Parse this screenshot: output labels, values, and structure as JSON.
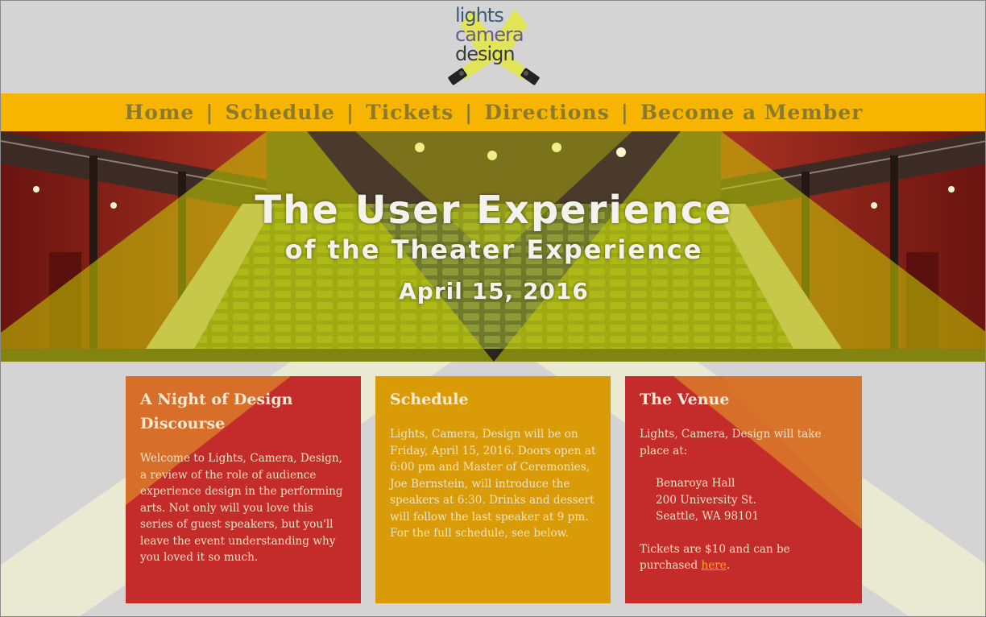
{
  "logo": {
    "lines": [
      "lights",
      "camera",
      "design"
    ]
  },
  "nav": {
    "items": [
      "Home",
      "Schedule",
      "Tickets",
      "Directions",
      "Become a Member"
    ],
    "separator": "|"
  },
  "hero": {
    "title": "The User Experience",
    "subtitle": "of the Theater Experience",
    "date": "April 15, 2016"
  },
  "cards": [
    {
      "title": "A Night of Design Discourse",
      "body": "Welcome to Lights, Camera, Design, a review of the role of audience experience design in the performing arts. Not only will you love this series of guest speakers, but you'll leave the event understanding why you loved it so much."
    },
    {
      "title": "Schedule",
      "body": "Lights, Camera, Design will be on Friday, April 15, 2016. Doors open at 6:00 pm and Master of Ceremonies, Joe Bernstein, will introduce the speakers at 6:30. Drinks and dessert will follow the last speaker at 9 pm. For the full schedule, see below."
    },
    {
      "title": "The Venue",
      "intro": "Lights, Camera, Design will take place at:",
      "address": [
        "Benaroya Hall",
        "200 University St.",
        "Seattle, WA 98101"
      ],
      "tickets_text": "Tickets are $10 and can be purchased",
      "tickets_link": "here",
      "tickets_end": "."
    }
  ],
  "colors": {
    "background": "#d4d4d4",
    "nav": "#f7b500",
    "nav_text": "#8b7a2e",
    "card_red": "#c42c2c",
    "card_gold": "#d99c08",
    "beam_yellow": "#d8e000",
    "beam_cream": "#ecebd0"
  }
}
